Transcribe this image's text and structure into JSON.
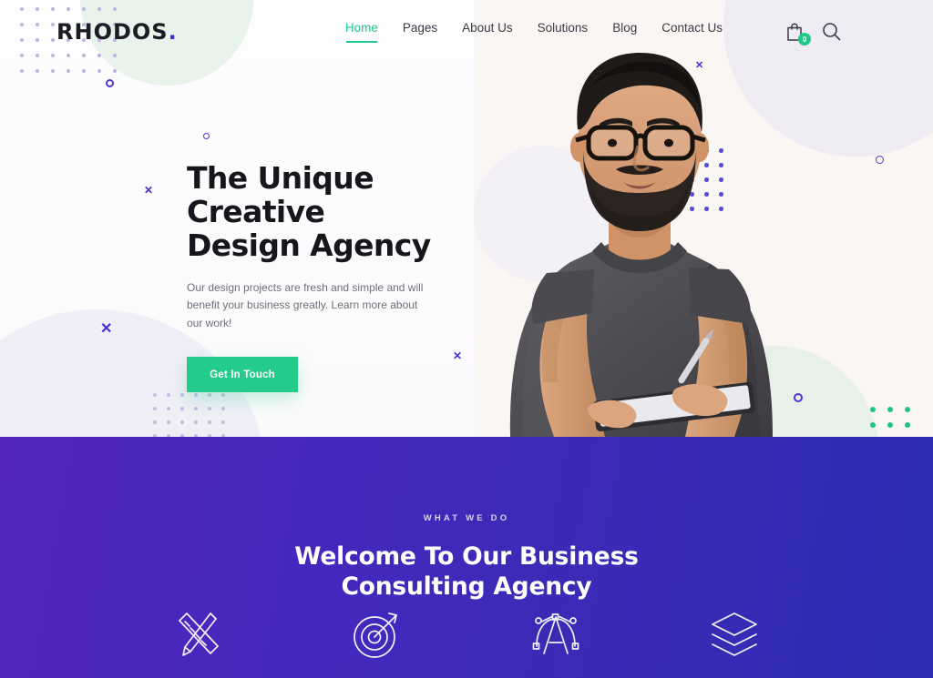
{
  "brand": {
    "name": "RHODOS",
    "dot": "."
  },
  "nav": {
    "items": [
      {
        "label": "Home",
        "active": true
      },
      {
        "label": "Pages",
        "active": false
      },
      {
        "label": "About Us",
        "active": false
      },
      {
        "label": "Solutions",
        "active": false
      },
      {
        "label": "Blog",
        "active": false
      },
      {
        "label": "Contact Us",
        "active": false
      }
    ],
    "cart_icon": "shopping-bag-icon",
    "cart_count": "0",
    "search_icon": "search-icon"
  },
  "hero": {
    "title_line1": "The Unique Creative",
    "title_line2": "Design Agency",
    "subtitle": "Our design projects are fresh and simple and will benefit your business greatly. Learn more about our work!",
    "cta_label": "Get In Touch",
    "person_alt": "bearded-man-with-glasses-holding-tablet"
  },
  "what_we_do": {
    "eyebrow": "WHAT WE DO",
    "title_line1": "Welcome To Our Business",
    "title_line2": "Consulting Agency",
    "icons": [
      {
        "name": "ruler-pencil-icon"
      },
      {
        "name": "target-arrow-icon"
      },
      {
        "name": "typography-vector-icon"
      },
      {
        "name": "layers-icon"
      }
    ]
  },
  "colors": {
    "accent_green": "#24cb8a",
    "accent_purple": "#4531d2",
    "purple_left": "#5226bb",
    "purple_right": "#2d2db2",
    "hero_bg": "#faf6f4",
    "text_dark": "#16161c"
  }
}
